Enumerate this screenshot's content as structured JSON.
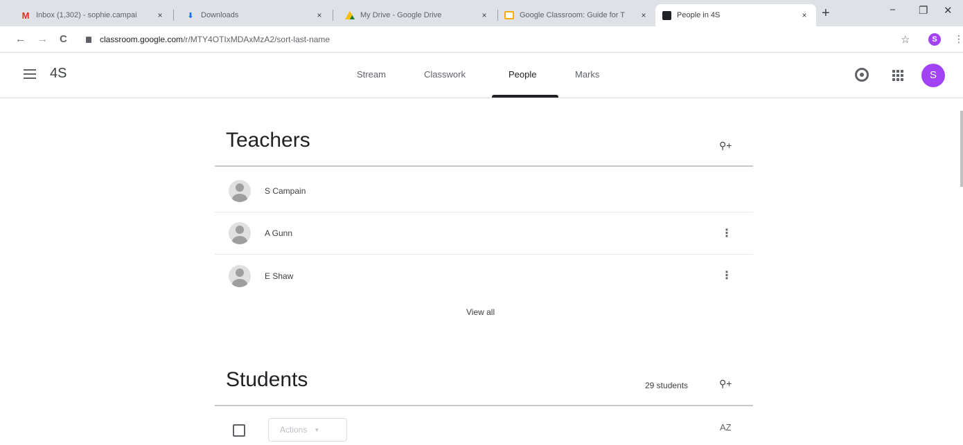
{
  "browser": {
    "tabs": [
      {
        "title": "Inbox (1,302) - sophie.campai",
        "icon": "gmail-icon"
      },
      {
        "title": "Downloads",
        "icon": "download-icon"
      },
      {
        "title": "My Drive - Google Drive",
        "icon": "drive-icon"
      },
      {
        "title": "Google Classroom: Guide for T",
        "icon": "classroom-icon"
      },
      {
        "title": "People in 4S",
        "icon": "people-icon",
        "active": true
      }
    ],
    "tab_close": "×",
    "new_tab": "+",
    "minimize": "−",
    "restore": "❐",
    "close": "✕",
    "back": "←",
    "forward": "→",
    "reload": "C",
    "url_domain": "classroom.google.com",
    "url_path": "/r/MTY4OTIxMDAxMzA2/sort-last-name",
    "bookmark": "☆",
    "profile_initial": "S",
    "menu": "⋮"
  },
  "header": {
    "class_name": "4S",
    "tabs": [
      "Stream",
      "Classwork",
      "People",
      "Marks"
    ],
    "active_tab": "People",
    "avatar_initial": "S",
    "accent": "#a142f4"
  },
  "teachers": {
    "title": "Teachers",
    "add_icon": "⚲+",
    "list": [
      {
        "name": "S Campain",
        "menu": ""
      },
      {
        "name": "A Gunn",
        "menu": "⋮"
      },
      {
        "name": "E Shaw",
        "menu": "⋮"
      }
    ],
    "view_all": "View all"
  },
  "students": {
    "title": "Students",
    "count": "29 students",
    "actions_label": "Actions",
    "caret": "▼",
    "sort_label": "AZ"
  }
}
